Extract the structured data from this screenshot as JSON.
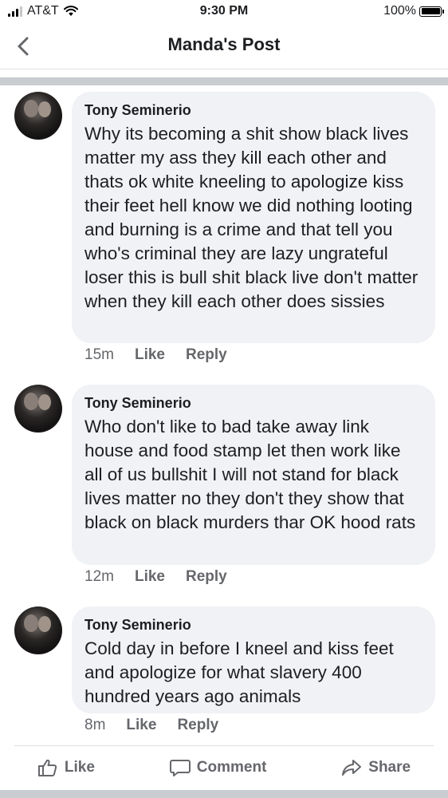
{
  "status_bar": {
    "carrier": "AT&T",
    "time": "9:30 PM",
    "battery": "100%"
  },
  "header": {
    "title": "Manda's Post",
    "back_icon": "chevron-left-icon"
  },
  "comments": [
    {
      "author": "Tony Seminerio",
      "text": "Why its becoming a shit show black lives matter my ass they kill each other and thats ok white kneeling to apologize kiss their feet hell know we did nothing looting and burning is a crime and that tell you who's criminal they are lazy ungrateful loser this is bull shit black live don't matter when they kill each other does sissies",
      "time": "15m",
      "like": "Like",
      "reply": "Reply"
    },
    {
      "author": "Tony Seminerio",
      "text": "Who don't like to bad take away link house and food stamp let then work like all of us bullshit I will not stand for black lives matter no they don't they show that black on black murders thar OK hood rats",
      "time": "12m",
      "like": "Like",
      "reply": "Reply"
    },
    {
      "author": "Tony Seminerio",
      "text": "Cold day in before I kneel and kiss feet and apologize for what slavery 400 hundred years ago animals",
      "time": "8m",
      "like": "Like",
      "reply": "Reply"
    }
  ],
  "footer": {
    "like": "Like",
    "comment": "Comment",
    "share": "Share"
  },
  "colors": {
    "bubble": "#f0f2f5",
    "meta_text": "#65676b",
    "separator": "#c9ccd1"
  }
}
